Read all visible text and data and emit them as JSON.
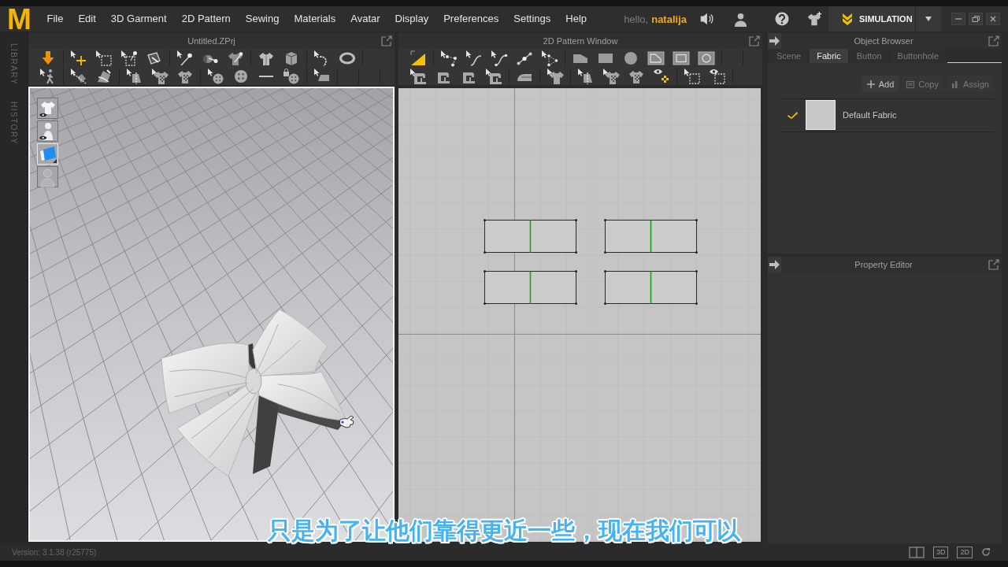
{
  "menu_bar": {
    "logo": "M",
    "items": [
      "File",
      "Edit",
      "3D Garment",
      "2D Pattern",
      "Sewing",
      "Materials",
      "Avatar",
      "Display",
      "Preferences",
      "Settings",
      "Help"
    ],
    "greeting": "hello,",
    "user_name": "natalija",
    "mode_button": "SIMULATION"
  },
  "side_tabs": [
    "LIBRARY",
    "HISTORY"
  ],
  "viewport_3d": {
    "title": "Untitled.ZPrj"
  },
  "pattern_window": {
    "title": "2D Pattern Window"
  },
  "object_browser": {
    "title": "Object Browser",
    "tabs": [
      {
        "label": "Scene",
        "selected": false
      },
      {
        "label": "Fabric",
        "selected": true
      },
      {
        "label": "Button",
        "selected": false
      },
      {
        "label": "Buttonhole",
        "selected": false
      }
    ],
    "actions": [
      {
        "label": "Add",
        "disabled": false
      },
      {
        "label": "Copy",
        "disabled": true
      },
      {
        "label": "Assign",
        "disabled": true
      }
    ],
    "fabrics": [
      {
        "name": "Default Fabric",
        "checked": true
      }
    ]
  },
  "property_editor": {
    "title": "Property Editor"
  },
  "status_bar": {
    "version": "Version: 3.1.38 (r25775)",
    "view_buttons": [
      "3D",
      "2D"
    ]
  },
  "subtitle": "只是为了让他们靠得更近一些，现在我们可以"
}
